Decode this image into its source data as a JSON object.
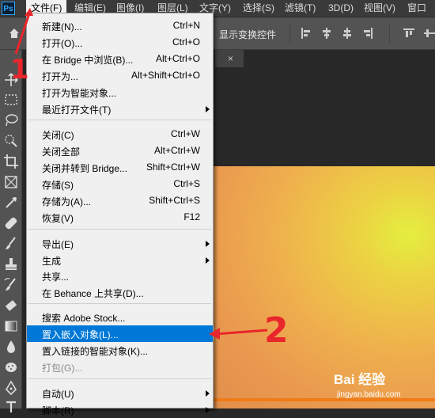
{
  "app": {
    "logo": "Ps"
  },
  "menubar": {
    "items": [
      "文件(F)",
      "编辑(E)",
      "图像(I)",
      "图层(L)",
      "文字(Y)",
      "选择(S)",
      "滤镜(T)",
      "3D(D)",
      "视图(V)",
      "窗口"
    ]
  },
  "options_bar": {
    "show_transform": "显示变换控件"
  },
  "doc_tab": {
    "close": "×"
  },
  "file_menu": {
    "items": [
      {
        "label": "新建(N)...",
        "shortcut": "Ctrl+N"
      },
      {
        "label": "打开(O)...",
        "shortcut": "Ctrl+O"
      },
      {
        "label": "在 Bridge 中浏览(B)...",
        "shortcut": "Alt+Ctrl+O"
      },
      {
        "label": "打开为...",
        "shortcut": "Alt+Shift+Ctrl+O"
      },
      {
        "label": "打开为智能对象..."
      },
      {
        "label": "最近打开文件(T)",
        "submenu": true
      },
      {
        "label": "关闭(C)",
        "shortcut": "Ctrl+W"
      },
      {
        "label": "关闭全部",
        "shortcut": "Alt+Ctrl+W"
      },
      {
        "label": "关闭并转到 Bridge...",
        "shortcut": "Shift+Ctrl+W"
      },
      {
        "label": "存储(S)",
        "shortcut": "Ctrl+S"
      },
      {
        "label": "存储为(A)...",
        "shortcut": "Shift+Ctrl+S"
      },
      {
        "label": "恢复(V)",
        "shortcut": "F12"
      },
      {
        "label": "导出(E)",
        "submenu": true
      },
      {
        "label": "生成",
        "submenu": true
      },
      {
        "label": "共享..."
      },
      {
        "label": "在 Behance 上共享(D)..."
      },
      {
        "label": "搜索 Adobe Stock..."
      },
      {
        "label": "置入嵌入对象(L)...",
        "highlighted": true
      },
      {
        "label": "置入链接的智能对象(K)..."
      },
      {
        "label": "打包(G)...",
        "disabled": true
      },
      {
        "label": "自动(U)",
        "submenu": true
      },
      {
        "label": "脚本(R)",
        "submenu": true
      }
    ]
  },
  "annotations": {
    "step1": "1",
    "step2": "2"
  },
  "watermark": {
    "logo": "Bai 经验",
    "url": "jingyan.baidu.com"
  },
  "colors": {
    "highlight": "#0078d7",
    "annotation": "#e8262b",
    "menu_bg": "#f0f0f0"
  }
}
